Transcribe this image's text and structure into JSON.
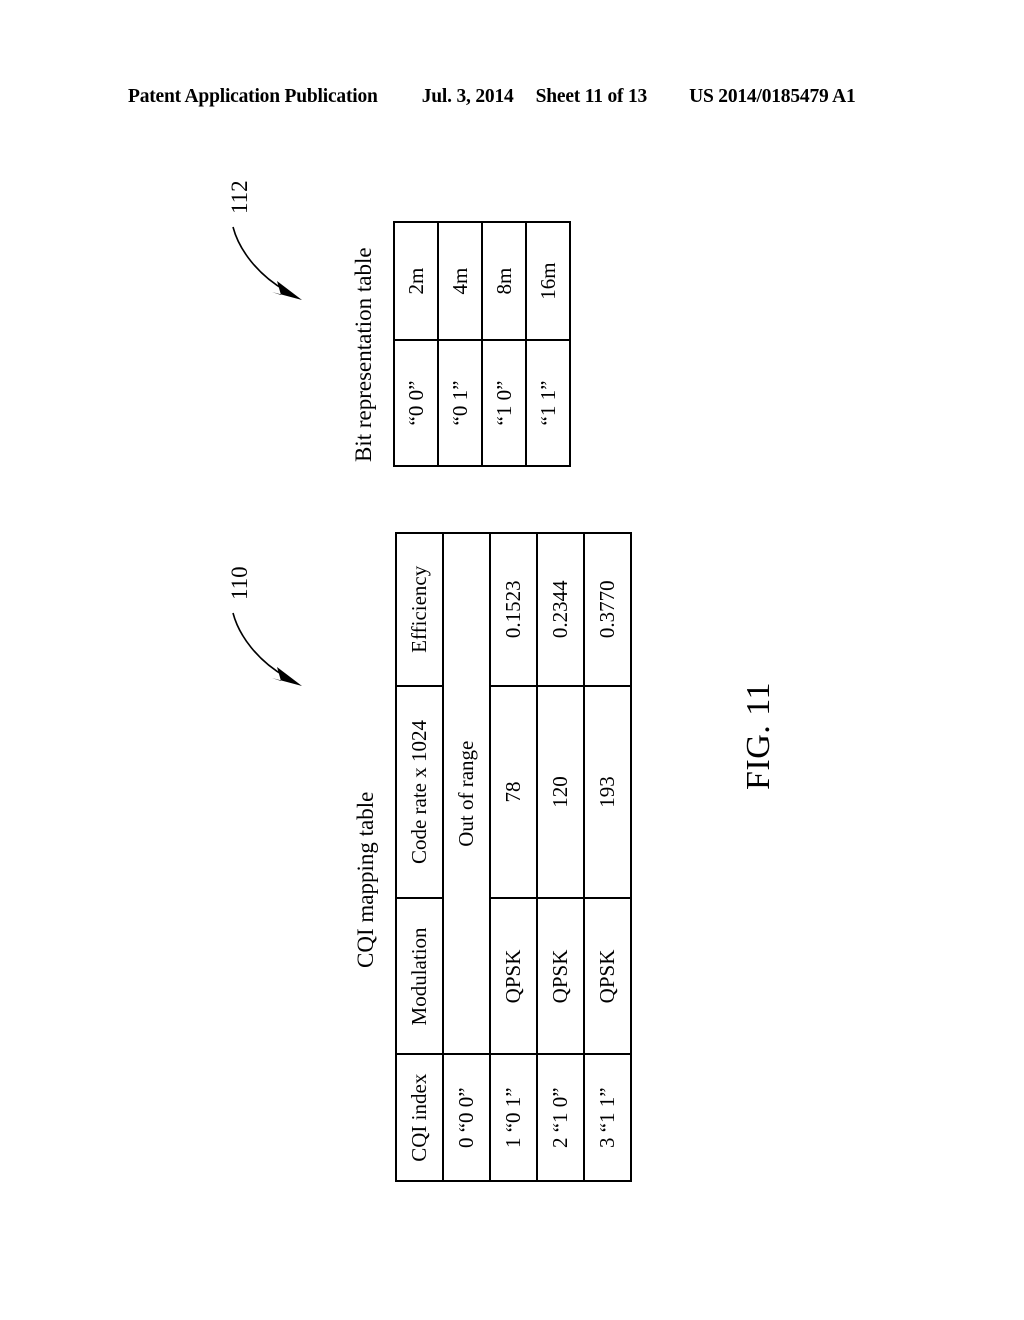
{
  "header": {
    "publication": "Patent Application Publication",
    "date": "Jul. 3, 2014",
    "sheet": "Sheet 11 of 13",
    "patent_number": "US 2014/0185479 A1"
  },
  "figure": {
    "label": "FIG. 11"
  },
  "cqi_mapping_table": {
    "caption": "CQI mapping table",
    "reference_numeral": "110",
    "columns": [
      "CQI index",
      "Modulation",
      "Code rate x 1024",
      "Efficiency"
    ],
    "merged_cell_text": "Out of range",
    "rows": [
      {
        "index": "0  “0 0”",
        "modulation": "",
        "code_rate": "Out of range",
        "efficiency": ""
      },
      {
        "index": "1  “0 1”",
        "modulation": "QPSK",
        "code_rate": "78",
        "efficiency": "0.1523"
      },
      {
        "index": "2  “1 0”",
        "modulation": "QPSK",
        "code_rate": "120",
        "efficiency": "0.2344"
      },
      {
        "index": "3  “1 1”",
        "modulation": "QPSK",
        "code_rate": "193",
        "efficiency": "0.3770"
      }
    ]
  },
  "bit_representation_table": {
    "caption": "Bit representation table",
    "reference_numeral": "112",
    "rows": [
      {
        "code": "“0 0”",
        "value": "2m"
      },
      {
        "code": "“0 1”",
        "value": "4m"
      },
      {
        "code": "“1 0”",
        "value": "8m"
      },
      {
        "code": "“1 1”",
        "value": "16m"
      }
    ]
  }
}
